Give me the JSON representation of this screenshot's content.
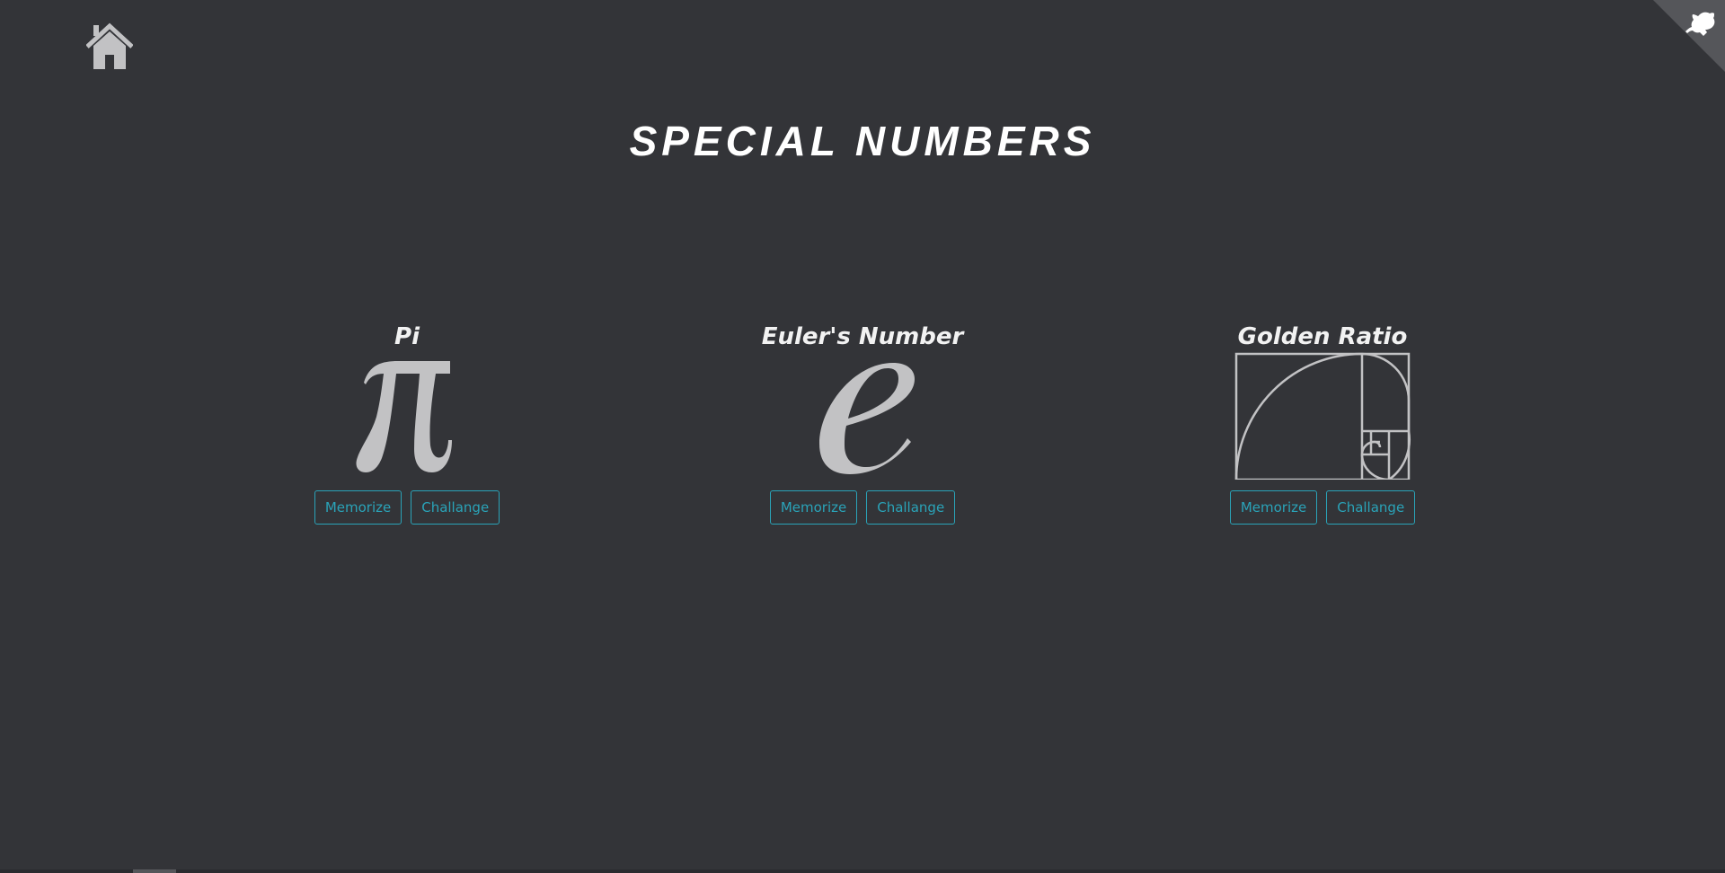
{
  "header": {
    "home_icon": "home-icon",
    "github_icon": "github-octocat-icon",
    "title": "SPECIAL NUMBERS"
  },
  "colors": {
    "background": "#333438",
    "accent": "#2aa3b8",
    "symbol": "#c2c2c4",
    "title": "#ffffff"
  },
  "cards": [
    {
      "title": "Pi",
      "symbol_icon": "pi-symbol-icon",
      "memorize_label": "Memorize",
      "challenge_label": "Challange"
    },
    {
      "title": "Euler's Number",
      "symbol_icon": "euler-e-symbol-icon",
      "memorize_label": "Memorize",
      "challenge_label": "Challange"
    },
    {
      "title": "Golden Ratio",
      "symbol_icon": "golden-spiral-icon",
      "memorize_label": "Memorize",
      "challenge_label": "Challange"
    }
  ]
}
